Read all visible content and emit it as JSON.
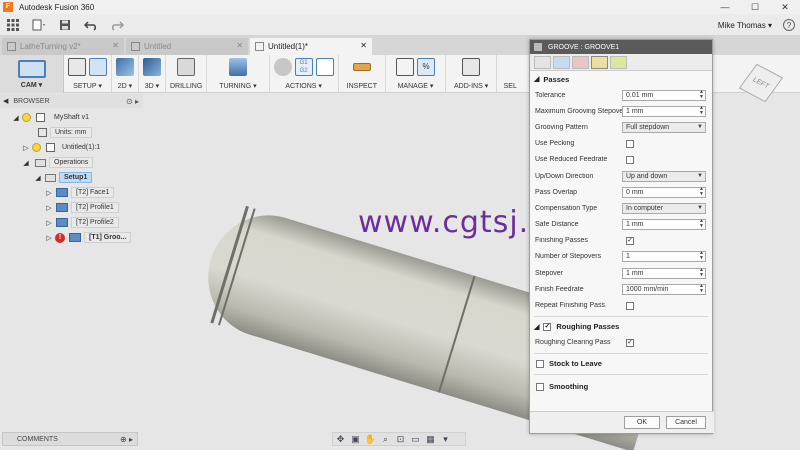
{
  "window": {
    "title": "Autodesk Fusion 360",
    "logo_letter": "F",
    "controls": [
      "—",
      "☐",
      "✕"
    ]
  },
  "quickbar": {
    "user_name": "Mike Thomas ▾",
    "help_icon": "?"
  },
  "tabs": [
    {
      "label": "LatheTurning v2*",
      "active": false
    },
    {
      "label": "Untitled",
      "active": false
    },
    {
      "label": "Untitled(1)*",
      "active": true
    }
  ],
  "ribbon": {
    "workspace": "CAM ▾",
    "groups": [
      {
        "label": "SETUP ▾"
      },
      {
        "label": "2D ▾"
      },
      {
        "label": "3D ▾"
      },
      {
        "label": "DRILLING"
      },
      {
        "label": "TURNING ▾"
      },
      {
        "label": "ACTIONS ▾"
      },
      {
        "label": "INSPECT"
      },
      {
        "label": "MANAGE ▾"
      },
      {
        "label": "ADD-INS ▾"
      },
      {
        "label": "SEL"
      }
    ]
  },
  "browser": {
    "title": "BROWSER",
    "items": {
      "root": "MyShaft v1",
      "units": "Units: mm",
      "component": "Untitled(1):1",
      "operations": "Operations",
      "setup": "Setup1",
      "op1": "[T2] Face1",
      "op2": "[T2] Profile1",
      "op3": "[T2] Profile2",
      "op4": "[T1] Groo..."
    }
  },
  "viewcube": {
    "face": "LEFT"
  },
  "watermark": "www.cgtsj.com",
  "dialog": {
    "title": "GROOVE : GROOVE1",
    "passes_header": "Passes",
    "rows": {
      "tolerance": {
        "label": "Tolerance",
        "value": "0.01 mm"
      },
      "max_stepover": {
        "label": "Maximum Grooving Stepove",
        "value": "1 mm"
      },
      "grooving_pattern": {
        "label": "Grooving Pattern",
        "value": "Full stepdown"
      },
      "use_pecking": {
        "label": "Use Pecking",
        "checked": false
      },
      "reduced_feedrate": {
        "label": "Use Reduced Feedrate",
        "checked": false
      },
      "updown_direction": {
        "label": "Up/Down Direction",
        "value": "Up and down"
      },
      "pass_overlap": {
        "label": "Pass Overlap",
        "value": "0 mm"
      },
      "compensation_type": {
        "label": "Compensation Type",
        "value": "In computer"
      },
      "safe_distance": {
        "label": "Safe Distance",
        "value": "1 mm"
      },
      "finishing_passes": {
        "label": "Finishing Passes",
        "checked": true
      },
      "num_stepovers": {
        "label": "Number of Stepovers",
        "value": "1"
      },
      "stepover": {
        "label": "Stepover",
        "value": "1 mm"
      },
      "finish_feedrate": {
        "label": "Finish Feedrate",
        "value": "1000 mm/min"
      },
      "repeat_finishing": {
        "label": "Repeat Finishing Pass",
        "checked": false
      }
    },
    "roughing_header": "Roughing Passes",
    "roughing_clearing": {
      "label": "Roughing Clearing Pass",
      "checked": true
    },
    "stock_to_leave": "Stock to Leave",
    "smoothing": "Smoothing",
    "ok": "OK",
    "cancel": "Cancel"
  },
  "bottom": {
    "comments": "COMMENTS"
  },
  "colors": {
    "accent": "#4a7fb8",
    "dialog_title_bg": "#5b5b5b",
    "watermark": "#6b2e9c",
    "error": "#d42a2a"
  }
}
